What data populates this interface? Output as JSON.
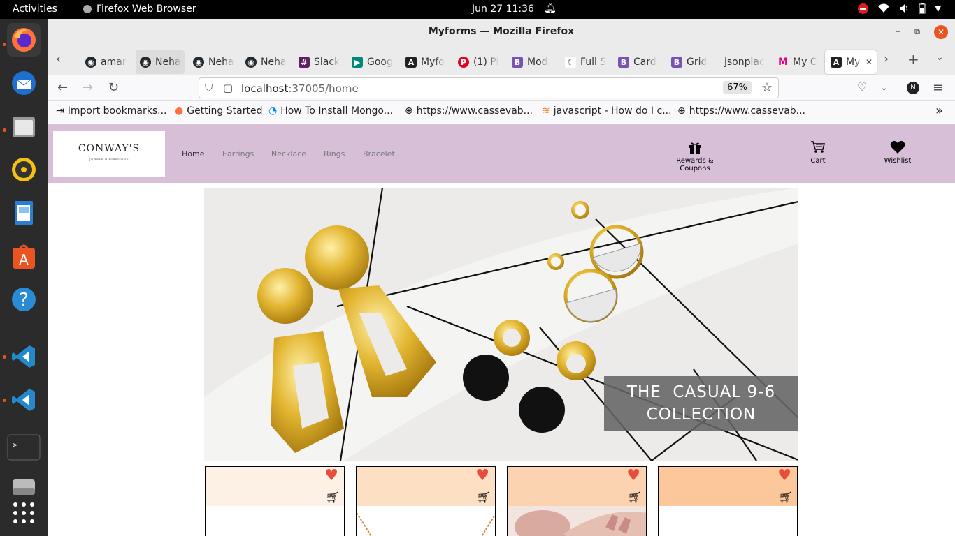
{
  "system_bar": {
    "activities": "Activities",
    "app_name": "Firefox Web Browser",
    "clock": "Jun 27  11:36"
  },
  "window": {
    "title": "Myforms — Mozilla Firefox"
  },
  "tabs": [
    {
      "label": "amar",
      "icon": "github-icon"
    },
    {
      "label": "Neha",
      "icon": "github-icon"
    },
    {
      "label": "Neha",
      "icon": "github-icon"
    },
    {
      "label": "Neha",
      "icon": "github-icon"
    },
    {
      "label": "Slack",
      "icon": "slack-icon"
    },
    {
      "label": "Goog",
      "icon": "google-meet-icon"
    },
    {
      "label": "Myfo",
      "icon": "angular-icon"
    },
    {
      "label": "(1) Pi",
      "icon": "pinterest-icon"
    },
    {
      "label": "Mod",
      "icon": "bootstrap-icon"
    },
    {
      "label": "Full S",
      "icon": "full-stack-icon"
    },
    {
      "label": "Card",
      "icon": "bootstrap-icon"
    },
    {
      "label": "Grid",
      "icon": "bootstrap-icon"
    },
    {
      "label": "jsonplac",
      "icon": ""
    },
    {
      "label": "My C",
      "icon": "m-logo-icon"
    },
    {
      "label": "My",
      "icon": "angular-icon"
    }
  ],
  "address_bar": {
    "host": "localhost",
    "path": ":37005/home",
    "zoom": "67%"
  },
  "bookmarks": [
    {
      "label": "Import bookmarks...",
      "icon": "import-icon"
    },
    {
      "label": "Getting Started",
      "icon": "firefox-icon"
    },
    {
      "label": "How To Install Mongo...",
      "icon": "digitalocean-icon"
    },
    {
      "label": "https://www.cassevab...",
      "icon": "globe-icon"
    },
    {
      "label": "javascript - How do I c...",
      "icon": "stackoverflow-icon"
    },
    {
      "label": "https://www.cassevab...",
      "icon": "globe-icon"
    }
  ],
  "site": {
    "logo": {
      "brand": "CONWAY'S",
      "tagline": "JEWELS & DIAMONDS"
    },
    "nav": [
      "Home",
      "Earrings",
      "Necklace",
      "Rings",
      "Bracelet"
    ],
    "actions": {
      "rewards": "Rewards & Coupons",
      "cart": "Cart",
      "wishlist": "Wishlist"
    },
    "hero_caption_line1": "THE  CASUAL 9-6",
    "hero_caption_line2": "COLLECTION"
  },
  "colors": {
    "header_bg": "#d8bfd8",
    "card_tops": [
      "#fdf0e4",
      "#fde0c4",
      "#fcd3b0",
      "#fcc79b"
    ],
    "heart": "#e74c3c"
  }
}
